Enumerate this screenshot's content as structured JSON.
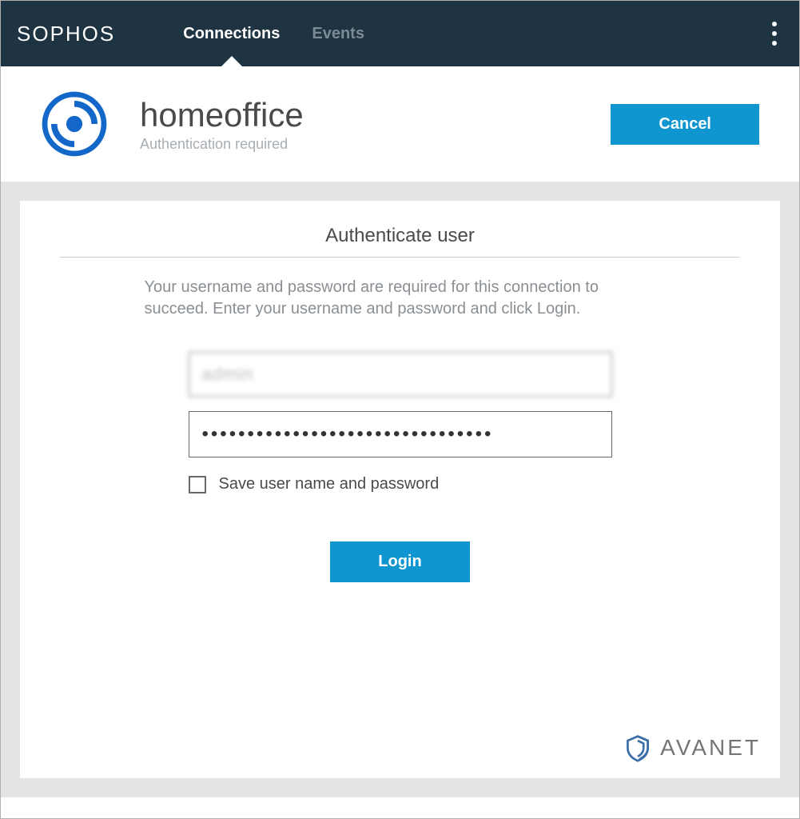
{
  "brand": "SOPHOS",
  "tabs": {
    "connections": "Connections",
    "events": "Events"
  },
  "connection": {
    "name": "homeoffice",
    "status": "Authentication required",
    "cancel_label": "Cancel"
  },
  "auth": {
    "title": "Authenticate user",
    "description": "Your username and password are required for this connection to succeed. Enter your username and password and click Login.",
    "username_value": "admin",
    "password_value": "••••••••••••••••••••••••••••••••",
    "save_label": "Save user name and password",
    "login_label": "Login"
  },
  "watermark": "AVANET"
}
